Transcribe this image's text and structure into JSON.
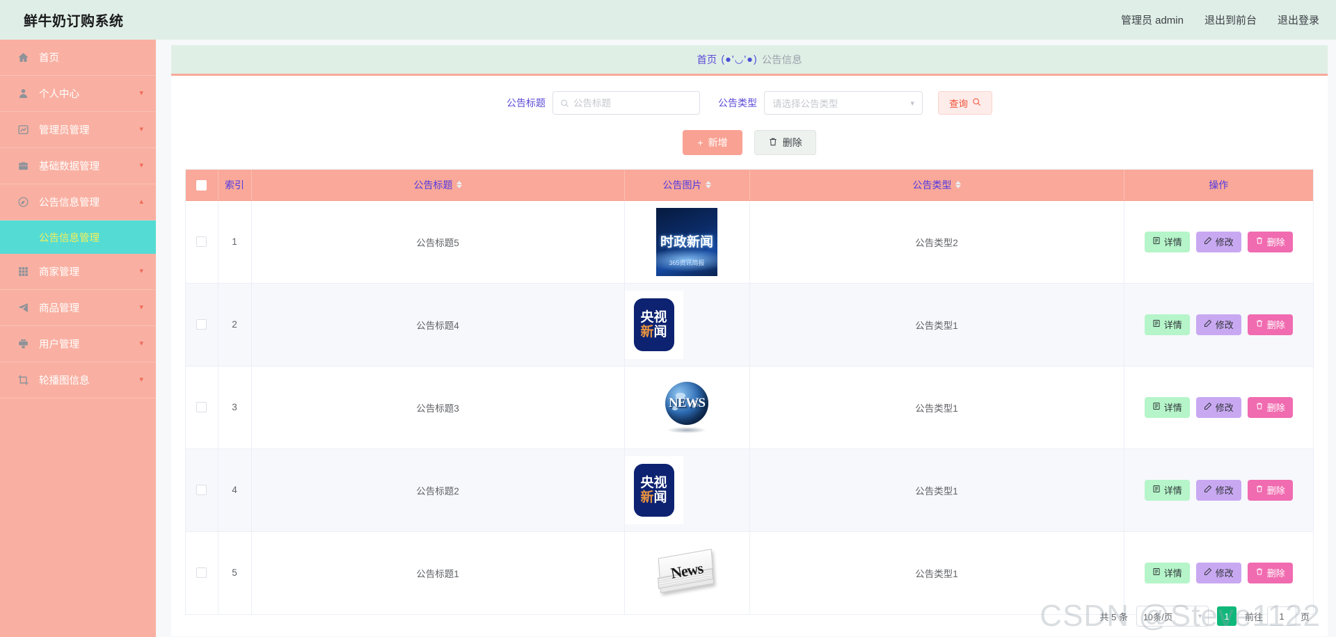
{
  "header": {
    "brand": "鲜牛奶订购系统",
    "links": [
      {
        "name": "admin-user",
        "label": "管理员 admin"
      },
      {
        "name": "exit-to-front",
        "label": "退出到前台"
      },
      {
        "name": "logout",
        "label": "退出登录"
      }
    ]
  },
  "sidebar": {
    "items": [
      {
        "label": "首页",
        "icon": "home-icon",
        "expandable": false
      },
      {
        "label": "个人中心",
        "icon": "user-icon",
        "expandable": true,
        "arrow": "▾"
      },
      {
        "label": "管理员管理",
        "icon": "chart-icon",
        "expandable": true,
        "arrow": "▾"
      },
      {
        "label": "基础数据管理",
        "icon": "briefcase-icon",
        "expandable": true,
        "arrow": "▾"
      },
      {
        "label": "公告信息管理",
        "icon": "compass-icon",
        "expandable": true,
        "arrow": "▴",
        "expanded": true
      },
      {
        "label": "商家管理",
        "icon": "grid-icon",
        "expandable": true,
        "arrow": "▾"
      },
      {
        "label": "商品管理",
        "icon": "paper-plane-icon",
        "expandable": true,
        "arrow": "▾"
      },
      {
        "label": "用户管理",
        "icon": "printer-icon",
        "expandable": true,
        "arrow": "▾"
      },
      {
        "label": "轮播图信息",
        "icon": "crop-icon",
        "expandable": true,
        "arrow": "▾"
      }
    ],
    "active_submenu": "公告信息管理"
  },
  "breadcrumb": {
    "home": "首页",
    "separator": "(●'◡'●)",
    "current": "公告信息"
  },
  "search": {
    "title_label": "公告标题",
    "title_value": "",
    "title_placeholder": "公告标题",
    "type_label": "公告类型",
    "type_value": "请选择公告类型",
    "query_button": "查询"
  },
  "actions": {
    "add": "新增",
    "delete": "删除"
  },
  "table": {
    "columns": [
      {
        "key": "select",
        "label": "",
        "sortable": false
      },
      {
        "key": "index",
        "label": "索引",
        "sortable": false
      },
      {
        "key": "title",
        "label": "公告标题",
        "sortable": true
      },
      {
        "key": "image",
        "label": "公告图片",
        "sortable": true
      },
      {
        "key": "type",
        "label": "公告类型",
        "sortable": true
      },
      {
        "key": "ops",
        "label": "操作",
        "sortable": false
      }
    ],
    "rows": [
      {
        "index": "1",
        "title": "公告标题5",
        "image": "时政新闻-365资讯简报",
        "image_text": "时政新闻",
        "image_sub": "365资讯简报",
        "type": "公告类型2"
      },
      {
        "index": "2",
        "title": "公告标题4",
        "image": "央视新闻",
        "image_text": "央视",
        "image_sub": "新闻",
        "type": "公告类型1"
      },
      {
        "index": "3",
        "title": "公告标题3",
        "image": "NEWS地球",
        "image_text": "NEWS",
        "image_sub": "",
        "type": "公告类型1"
      },
      {
        "index": "4",
        "title": "公告标题2",
        "image": "央视新闻",
        "image_text": "央视",
        "image_sub": "新闻",
        "type": "公告类型1"
      },
      {
        "index": "5",
        "title": "公告标题1",
        "image": "News报纸",
        "image_text": "News",
        "image_sub": "",
        "type": "公告类型1"
      }
    ],
    "row_ops": {
      "detail": "详情",
      "edit": "修改",
      "delete": "删除"
    }
  },
  "pagination": {
    "total": "共 5 条",
    "page_size": "10条/页",
    "pages": [
      "1"
    ],
    "current_page": "1",
    "jump_prefix": "前往",
    "jump_value": "1",
    "jump_suffix": "页"
  },
  "watermark": "CSDN @Steve1122",
  "colors": {
    "header_bg": "#dfeee6",
    "sidebar_bg": "#f9b0a2",
    "submenu_active_bg": "#54dcd4",
    "submenu_active_text": "#f5ef5a",
    "table_header_bg": "#f9a899",
    "table_header_text": "#5139e0",
    "accent_salmon": "#f9a293",
    "detail_btn": "#b5f5c9",
    "edit_btn": "#c9a8f2",
    "delete_btn": "#f06bb0",
    "pager_active": "#0fb87a"
  }
}
